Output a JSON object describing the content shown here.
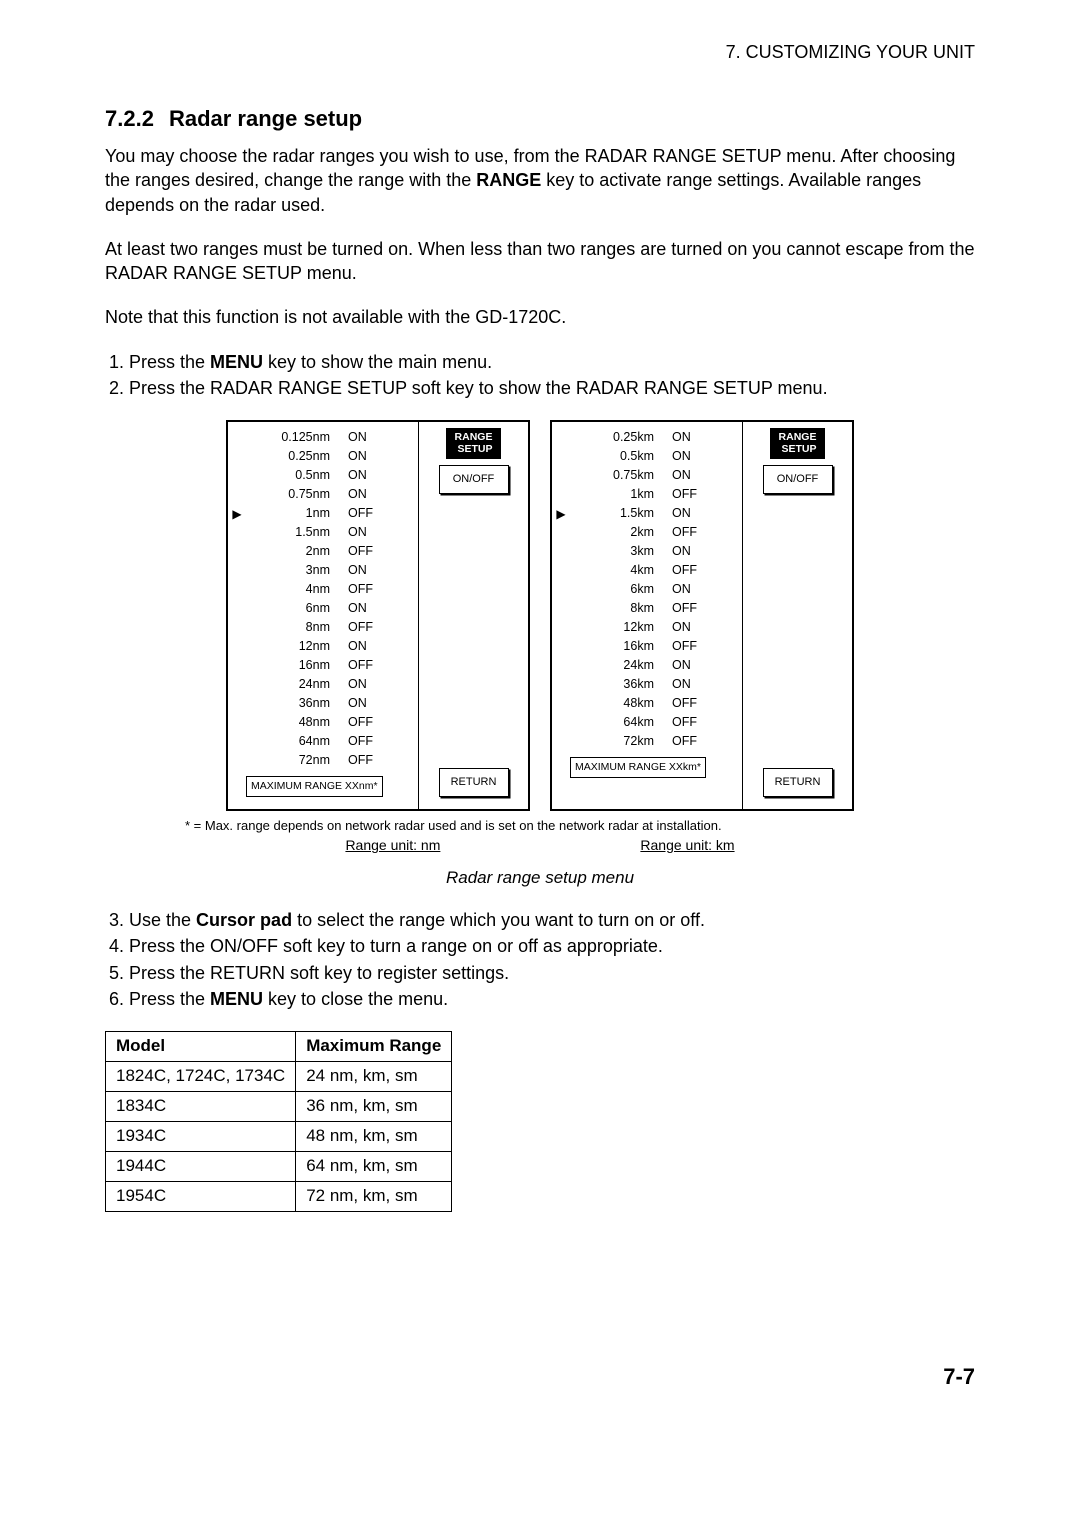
{
  "header": {
    "chapter": "7. CUSTOMIZING YOUR UNIT"
  },
  "section": {
    "number": "7.2.2",
    "title": "Radar range setup"
  },
  "para1_a": "You may choose the radar ranges you wish to use, from the RADAR RANGE SETUP menu. After choosing the ranges desired, change the range with the ",
  "para1_b": "RANGE",
  "para1_c": " key to activate range settings. Available ranges depends on the radar used.",
  "para2": "At least two ranges must be turned on. When less than two ranges are turned on you cannot escape from the RADAR RANGE SETUP menu.",
  "para3": "Note that this function is not available with the GD-1720C.",
  "steps_top": [
    {
      "pre": "Press the ",
      "bold": "MENU",
      "post": " key to show the main menu."
    },
    {
      "pre": "Press the RADAR RANGE SETUP soft key to show the RADAR RANGE SETUP menu.",
      "bold": "",
      "post": ""
    }
  ],
  "menus": {
    "nm": {
      "rows": [
        {
          "label": "0.125nm",
          "state": "ON",
          "ptr": ""
        },
        {
          "label": "0.25nm",
          "state": "ON",
          "ptr": ""
        },
        {
          "label": "0.5nm",
          "state": "ON",
          "ptr": ""
        },
        {
          "label": "0.75nm",
          "state": "ON",
          "ptr": ""
        },
        {
          "label": "1nm",
          "state": "OFF",
          "ptr": "▶"
        },
        {
          "label": "1.5nm",
          "state": "ON",
          "ptr": ""
        },
        {
          "label": "2nm",
          "state": "OFF",
          "ptr": ""
        },
        {
          "label": "3nm",
          "state": "ON",
          "ptr": ""
        },
        {
          "label": "4nm",
          "state": "OFF",
          "ptr": ""
        },
        {
          "label": "6nm",
          "state": "ON",
          "ptr": ""
        },
        {
          "label": "8nm",
          "state": "OFF",
          "ptr": ""
        },
        {
          "label": "12nm",
          "state": "ON",
          "ptr": ""
        },
        {
          "label": "16nm",
          "state": "OFF",
          "ptr": ""
        },
        {
          "label": "24nm",
          "state": "ON",
          "ptr": ""
        },
        {
          "label": "36nm",
          "state": "ON",
          "ptr": ""
        },
        {
          "label": "48nm",
          "state": "OFF",
          "ptr": ""
        },
        {
          "label": "64nm",
          "state": "OFF",
          "ptr": ""
        },
        {
          "label": "72nm",
          "state": "OFF",
          "ptr": ""
        }
      ],
      "max": "MAXIMUM RANGE XXnm*"
    },
    "km": {
      "rows": [
        {
          "label": "0.25km",
          "state": "ON",
          "ptr": ""
        },
        {
          "label": "0.5km",
          "state": "ON",
          "ptr": ""
        },
        {
          "label": "0.75km",
          "state": "ON",
          "ptr": ""
        },
        {
          "label": "1km",
          "state": "OFF",
          "ptr": ""
        },
        {
          "label": "1.5km",
          "state": "ON",
          "ptr": "▶"
        },
        {
          "label": "2km",
          "state": "OFF",
          "ptr": ""
        },
        {
          "label": "3km",
          "state": "ON",
          "ptr": ""
        },
        {
          "label": "4km",
          "state": "OFF",
          "ptr": ""
        },
        {
          "label": "6km",
          "state": "ON",
          "ptr": ""
        },
        {
          "label": "8km",
          "state": "OFF",
          "ptr": ""
        },
        {
          "label": "12km",
          "state": "ON",
          "ptr": ""
        },
        {
          "label": "16km",
          "state": "OFF",
          "ptr": ""
        },
        {
          "label": "24km",
          "state": "ON",
          "ptr": ""
        },
        {
          "label": "36km",
          "state": "ON",
          "ptr": ""
        },
        {
          "label": "48km",
          "state": "OFF",
          "ptr": ""
        },
        {
          "label": "64km",
          "state": "OFF",
          "ptr": ""
        },
        {
          "label": "72km",
          "state": "OFF",
          "ptr": ""
        }
      ],
      "max": "MAXIMUM RANGE XXkm*"
    },
    "softkeys": {
      "title_line1": "RANGE",
      "title_line2": "SETUP",
      "onoff": "ON/OFF",
      "return": "RETURN"
    }
  },
  "footnote": "* =  Max. range depends on network radar used and is set on the network radar at installation.",
  "unit_labels": {
    "nm": "Range unit: nm",
    "km": "Range unit: km"
  },
  "fig_caption": "Radar range setup menu",
  "steps_bottom": [
    {
      "pre": "Use the ",
      "bold": "Cursor pad",
      "post": " to select the range which you want to turn on or off."
    },
    {
      "pre": "Press the ON/OFF soft key to turn a range on or off as appropriate.",
      "bold": "",
      "post": ""
    },
    {
      "pre": "Press the RETURN soft key to register settings.",
      "bold": "",
      "post": ""
    },
    {
      "pre": "Press the ",
      "bold": "MENU",
      "post": " key to close the menu."
    }
  ],
  "table": {
    "headers": [
      "Model",
      "Maximum Range"
    ],
    "rows": [
      [
        "1824C, 1724C, 1734C",
        "24 nm, km, sm"
      ],
      [
        "1834C",
        "36 nm, km, sm"
      ],
      [
        "1934C",
        "48 nm, km, sm"
      ],
      [
        "1944C",
        "64 nm, km, sm"
      ],
      [
        "1954C",
        "72 nm, km, sm"
      ]
    ]
  },
  "page_num": "7-7"
}
